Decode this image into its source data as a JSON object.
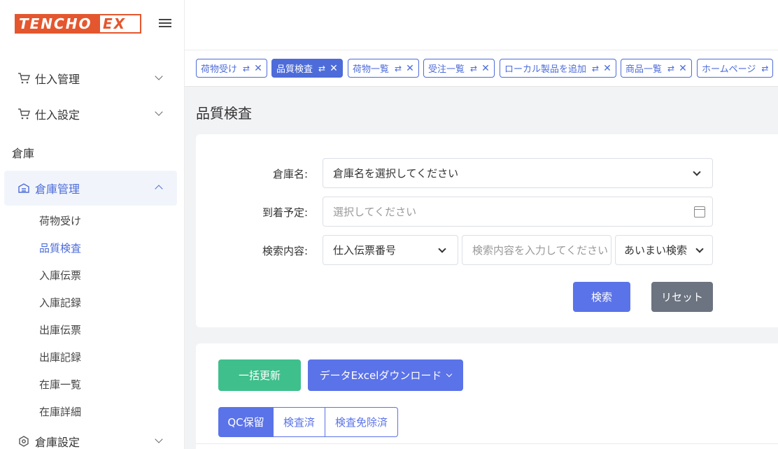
{
  "brand": {
    "part1": "TENCHO",
    "part2": "EX"
  },
  "sidebar": {
    "groups": [
      {
        "label": "仕入管理",
        "icon": "cart-icon"
      },
      {
        "label": "仕入設定",
        "icon": "cart-settings-icon"
      }
    ],
    "section_title": "倉庫",
    "warehouse_group": {
      "label": "倉庫管理",
      "icon": "warehouse-icon"
    },
    "sub_items": [
      "荷物受け",
      "品質検査",
      "入庫伝票",
      "入庫記録",
      "出庫伝票",
      "出庫記録",
      "在庫一覧",
      "在庫詳細"
    ],
    "active_sub_item": "品質検査",
    "settings_group": {
      "label": "倉庫設定",
      "icon": "warehouse-settings-icon"
    }
  },
  "tabs": [
    {
      "label": "荷物受け"
    },
    {
      "label": "品質検査"
    },
    {
      "label": "荷物一覧"
    },
    {
      "label": "受注一覧"
    },
    {
      "label": "ローカル製品を追加"
    },
    {
      "label": "商品一覧"
    },
    {
      "label": "ホームページ"
    }
  ],
  "tab_switch_glyph": "⇄",
  "tab_close_glyph": "✕",
  "page_title": "品質検査",
  "search_form": {
    "warehouse_label": "倉庫名:",
    "warehouse_placeholder": "倉庫名を選択してください",
    "arrival_label": "到着予定:",
    "arrival_placeholder": "選択してください",
    "content_label": "検索内容:",
    "content_type": "仕入伝票番号",
    "content_placeholder": "検索内容を入力してください",
    "match_mode": "あいまい検索",
    "search_button": "検索",
    "reset_button": "リセット"
  },
  "list": {
    "bulk_update_button": "一括更新",
    "excel_button": "データExcelダウンロード",
    "status_tabs": [
      "QC保留",
      "検査済",
      "検査免除済"
    ],
    "active_status_tab": "QC保留"
  },
  "colors": {
    "accent": "#4d6cd9",
    "button_primary": "#5b73e8",
    "button_green": "#3fbf8c",
    "button_gray": "#6c7381",
    "brand_orange": "#e4572e"
  }
}
